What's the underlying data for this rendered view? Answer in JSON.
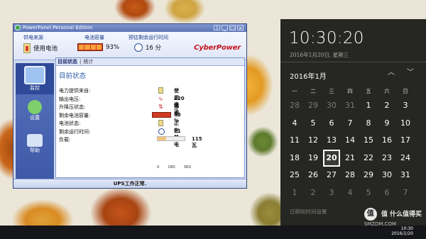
{
  "window": {
    "title": "PowerPanel Personal Edition",
    "controls": {
      "help": "?",
      "minimize": "_",
      "restore": "□",
      "close": "✕"
    },
    "brand": "CyberPower"
  },
  "header": {
    "power_source": {
      "label": "供电来源",
      "value": "使用电池"
    },
    "battery_capacity": {
      "label": "电池容量",
      "value": "93%",
      "fill_fraction": 0.93
    },
    "runtime": {
      "label": "预估剩余运行时间",
      "value": "16 分"
    }
  },
  "nav": {
    "items": [
      {
        "label": "监控",
        "icon": "monitor-icon",
        "active": true
      },
      {
        "label": "设置",
        "icon": "settings-icon",
        "active": false
      },
      {
        "label": "帮助",
        "icon": "help-book-icon",
        "active": false
      }
    ]
  },
  "content": {
    "tabs": [
      {
        "label": "目前状态",
        "active": true
      },
      {
        "label": "统计",
        "active": false
      }
    ],
    "section_title": "目前状态",
    "rows": [
      {
        "label": "电力提供来自:",
        "icon": "battery-icon",
        "value": "使用电池"
      },
      {
        "label": "输出电压:",
        "icon": "voltage-wave-icon",
        "value": "220 伏"
      },
      {
        "label": "升降压状态:",
        "icon": "boost-icon",
        "value": "停电"
      },
      {
        "label": "剩余电池容量:",
        "icon": "battery-bar-icon",
        "value": "93 %",
        "fill_fraction": 0.93
      },
      {
        "label": "电池状态:",
        "icon": "battery-status-icon",
        "value": "正在放电"
      },
      {
        "label": "剩余运行时间:",
        "icon": "clock-icon",
        "value": "21 分"
      },
      {
        "label": "负载:",
        "icon": "load-bar-icon",
        "value": "115 瓦",
        "fill_fraction": 0.32
      }
    ],
    "load_scale": [
      "0",
      "180",
      "360"
    ]
  },
  "statusbar": {
    "text": "UPS工作正常."
  },
  "flyout": {
    "time": "10:30:20",
    "date": "2016年1月20日, 星期三",
    "month": "2016年1月",
    "prev_icon": "chevron-up-icon",
    "next_icon": "chevron-down-icon",
    "weekdays": [
      "一",
      "二",
      "三",
      "四",
      "五",
      "六",
      "日"
    ],
    "weeks": [
      [
        {
          "d": "28",
          "o": true
        },
        {
          "d": "29",
          "o": true
        },
        {
          "d": "30",
          "o": true
        },
        {
          "d": "31",
          "o": true
        },
        {
          "d": "1",
          "o": false
        },
        {
          "d": "2",
          "o": false
        },
        {
          "d": "3",
          "o": false
        }
      ],
      [
        {
          "d": "4",
          "o": false
        },
        {
          "d": "5",
          "o": false
        },
        {
          "d": "6",
          "o": false
        },
        {
          "d": "7",
          "o": false
        },
        {
          "d": "8",
          "o": false
        },
        {
          "d": "9",
          "o": false
        },
        {
          "d": "10",
          "o": false
        }
      ],
      [
        {
          "d": "11",
          "o": false
        },
        {
          "d": "12",
          "o": false
        },
        {
          "d": "13",
          "o": false
        },
        {
          "d": "14",
          "o": false
        },
        {
          "d": "15",
          "o": false
        },
        {
          "d": "16",
          "o": false
        },
        {
          "d": "17",
          "o": false
        }
      ],
      [
        {
          "d": "18",
          "o": false
        },
        {
          "d": "19",
          "o": false
        },
        {
          "d": "20",
          "o": false,
          "today": true
        },
        {
          "d": "21",
          "o": false
        },
        {
          "d": "22",
          "o": false
        },
        {
          "d": "23",
          "o": false
        },
        {
          "d": "24",
          "o": false
        }
      ],
      [
        {
          "d": "25",
          "o": false
        },
        {
          "d": "26",
          "o": false
        },
        {
          "d": "27",
          "o": false
        },
        {
          "d": "28",
          "o": false
        },
        {
          "d": "29",
          "o": false
        },
        {
          "d": "30",
          "o": false
        },
        {
          "d": "31",
          "o": false
        }
      ],
      [
        {
          "d": "1",
          "o": true
        },
        {
          "d": "2",
          "o": true
        },
        {
          "d": "3",
          "o": true
        },
        {
          "d": "4",
          "o": true
        },
        {
          "d": "5",
          "o": true
        },
        {
          "d": "6",
          "o": true
        },
        {
          "d": "7",
          "o": true
        }
      ]
    ],
    "settings_link": "日期和时间设置"
  },
  "taskbar": {
    "time": "10:30",
    "date": "2016/1/20"
  },
  "watermark": {
    "text": "值 什么值得买",
    "site": "SMZDM.COM"
  }
}
